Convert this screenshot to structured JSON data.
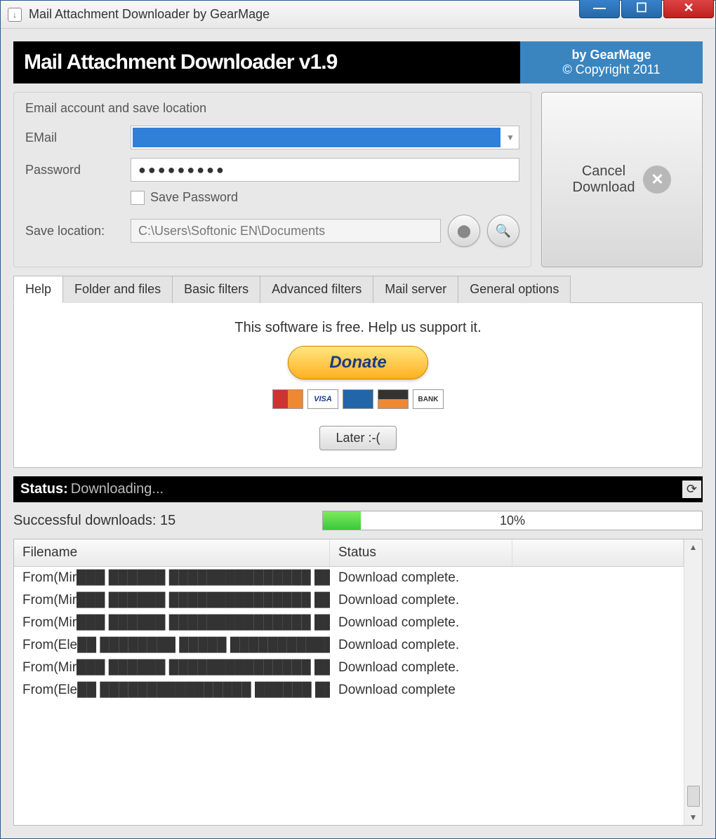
{
  "window": {
    "title": "Mail Attachment Downloader by GearMage"
  },
  "banner": {
    "title": "Mail Attachment Downloader v1.9",
    "brand_by": "by GearMage",
    "brand_copy": "© Copyright 2011"
  },
  "account": {
    "group_title": "Email account and save location",
    "email_label": "EMail",
    "password_label": "Password",
    "password_value": "●●●●●●●●●",
    "save_pw_label": "Save Password",
    "save_loc_label": "Save location:",
    "save_loc_value": "C:\\Users\\Softonic EN\\Documents"
  },
  "cancel_label": "Cancel\nDownload",
  "tabs": [
    "Help",
    "Folder and files",
    "Basic filters",
    "Advanced filters",
    "Mail server",
    "General options"
  ],
  "help": {
    "text": "This software is free. Help us support it.",
    "donate_label": "Donate",
    "later_label": "Later :-("
  },
  "status": {
    "label": "Status:",
    "text": "Downloading..."
  },
  "downloads": {
    "count_label": "Successful downloads: 15",
    "percent": "10%"
  },
  "table": {
    "col_filename": "Filename",
    "col_status": "Status",
    "rows": [
      {
        "filename": "From(Mir███ ██████  ███████████████ ███)...",
        "status": "Download complete."
      },
      {
        "filename": "From(Mir███ ██████  ███████████████ ███)...",
        "status": "Download complete."
      },
      {
        "filename": "From(Mir███ ██████  ███████████████ ███)...",
        "status": "Download complete."
      },
      {
        "filename": "From(Ele██ ████████  █████ ███████████████c...",
        "status": "Download complete."
      },
      {
        "filename": "From(Mir███ ██████  ███████████████ ███)...",
        "status": "Download complete."
      },
      {
        "filename": "From(Ele██ ████████████████ ██████ ██████ ██",
        "status": "Download complete"
      }
    ]
  }
}
